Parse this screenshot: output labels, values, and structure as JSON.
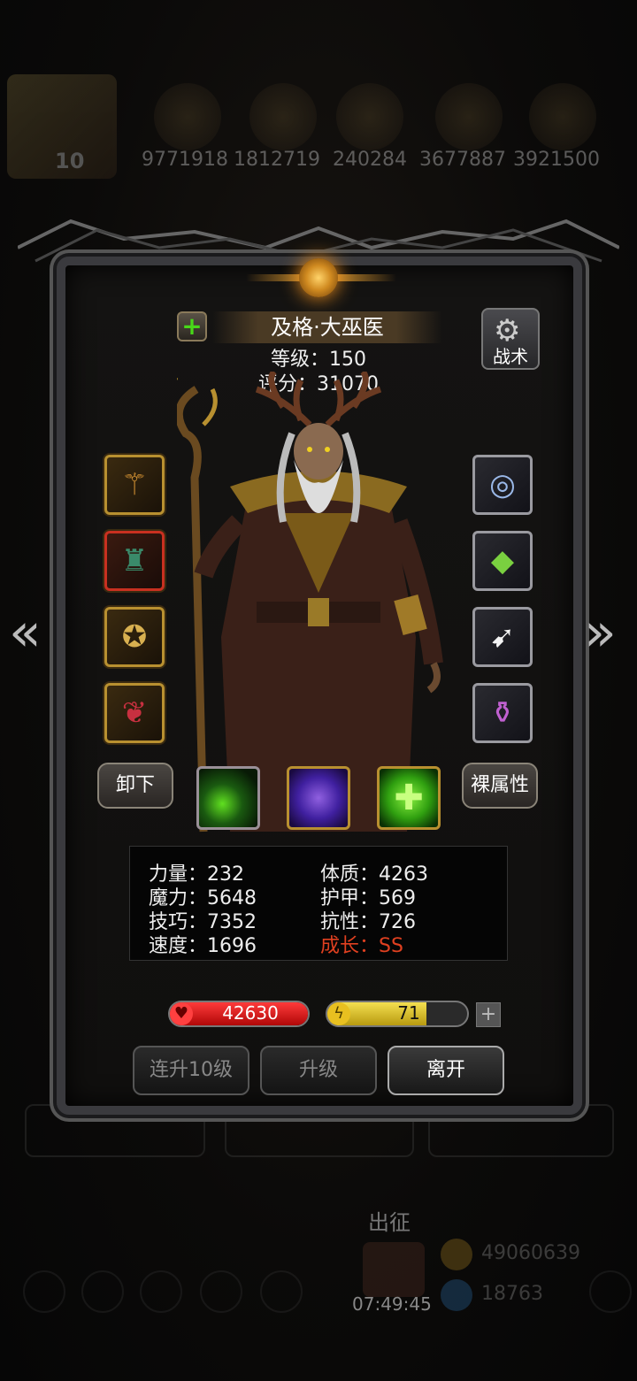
{
  "resources": {
    "avatar_level": "10",
    "values": [
      "9771918",
      "1812719",
      "240284",
      "3677887",
      "3921500"
    ]
  },
  "hero": {
    "name": "及格·大巫医",
    "level_text": "等级：150",
    "score_text": "评分：31070",
    "tactic_label": "战术"
  },
  "equipment_left": [
    {
      "name": "staff",
      "icon": "staff-icon"
    },
    {
      "name": "robe",
      "icon": "robe-icon"
    },
    {
      "name": "medallion",
      "icon": "medallion-icon"
    },
    {
      "name": "amulet",
      "icon": "amulet-icon"
    }
  ],
  "equipment_right": [
    {
      "name": "wind",
      "icon": "wind-icon"
    },
    {
      "name": "crystal",
      "icon": "crystal-icon"
    },
    {
      "name": "wing",
      "icon": "wing-icon"
    },
    {
      "name": "potion",
      "icon": "potion-icon"
    }
  ],
  "buttons": {
    "unequip": "卸下",
    "base_attr": "裸属性",
    "level_up_10": "连升10级",
    "level_up": "升级",
    "leave": "离开"
  },
  "stats": {
    "strength": "力量：232",
    "constitution": "体质：4263",
    "magic": "魔力：5648",
    "armor": "护甲：569",
    "skill": "技巧：7352",
    "resistance": "抗性：726",
    "speed": "速度：1696",
    "growth": "成长：SS"
  },
  "bars": {
    "hp": "42630",
    "hp_fill": 1.0,
    "energy": "71",
    "energy_fill": 0.71
  },
  "bottom": {
    "expedition": "出征",
    "timer": "07:49:45",
    "gold": "49060639",
    "gems": "18763"
  },
  "colors": {
    "hp": "#d01010",
    "energy": "#e0c830",
    "growth": "#e04020",
    "accent_gold": "#b89030"
  }
}
